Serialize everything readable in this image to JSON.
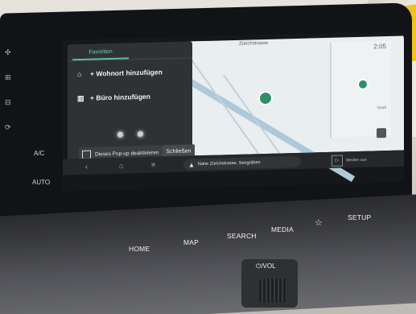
{
  "panel": {
    "tab_label": "Favoriten",
    "home_item": "+ Wohnort hinzufügen",
    "office_item": "+ Büro hinzufügen",
    "checkbox_label": "Dieses Pop-up deaktivieren",
    "close_label": "Schließen"
  },
  "map": {
    "location_label": "Zürichstrasse",
    "time": "2:05",
    "side_label": "Stadt"
  },
  "bottom_bar": {
    "route_text": "Nahe Zürichstrasse, Seegräben",
    "media_label": "Medien aus"
  },
  "console": {
    "ac_label": "A/C",
    "auto_label": "AUTO"
  },
  "hardware": {
    "home": "HOME",
    "map": "MAP",
    "search": "SEARCH",
    "media": "MEDIA",
    "setup": "SETUP",
    "vol": "⏻/VOL"
  },
  "colors": {
    "accent": "#5fbf9f",
    "panel_bg": "#2f3235",
    "map_bg": "#e9eef1"
  },
  "icons": {
    "home": "home-icon",
    "office": "building-icon",
    "back": "back-icon",
    "nav_home": "house-outline-icon",
    "menu": "menu-icon",
    "route_arrow": "navigation-arrow-icon",
    "star": "star-icon"
  }
}
